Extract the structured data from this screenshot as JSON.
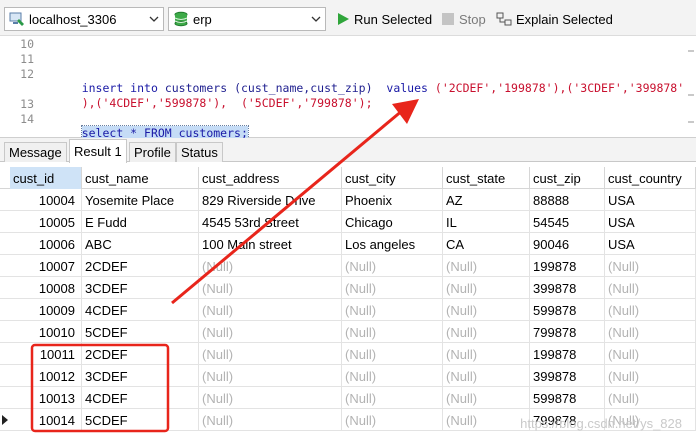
{
  "toolbar": {
    "connection": "localhost_3306",
    "database": "erp",
    "run_selected": "Run Selected",
    "stop": "Stop",
    "explain_selected": "Explain Selected"
  },
  "editor": {
    "lines": [
      {
        "num": "10"
      },
      {
        "num": "11"
      },
      {
        "num": "12",
        "insert_kw": "insert into",
        "table": "customers",
        "cols": "(cust_name,cust_zip)",
        "values_kw": "values",
        "vals": "('2CDEF','199878'),('3CDEF','399878'"
      },
      {
        "num": "",
        "cont": "),('4CDEF','599878'),  ('5CDEF','799878');"
      },
      {
        "num": "13"
      },
      {
        "num": "14",
        "select_sql": "select * FROM customers;"
      }
    ]
  },
  "tabs": [
    "Message",
    "Result 1",
    "Profile",
    "Status"
  ],
  "active_tab": "Result 1",
  "grid": {
    "columns": [
      "cust_id",
      "cust_name",
      "cust_address",
      "cust_city",
      "cust_state",
      "cust_zip",
      "cust_country"
    ],
    "rows": [
      [
        "10004",
        "Yosemite Place",
        "829 Riverside Drive",
        "Phoenix",
        "AZ",
        "88888",
        "USA"
      ],
      [
        "10005",
        "E Fudd",
        "4545 53rd Street",
        "Chicago",
        "IL",
        "54545",
        "USA"
      ],
      [
        "10006",
        "ABC",
        "100 Main street",
        "Los angeles",
        "CA",
        "90046",
        "USA"
      ],
      [
        "10007",
        "2CDEF",
        "(Null)",
        "(Null)",
        "(Null)",
        "199878",
        "(Null)"
      ],
      [
        "10008",
        "3CDEF",
        "(Null)",
        "(Null)",
        "(Null)",
        "399878",
        "(Null)"
      ],
      [
        "10009",
        "4CDEF",
        "(Null)",
        "(Null)",
        "(Null)",
        "599878",
        "(Null)"
      ],
      [
        "10010",
        "5CDEF",
        "(Null)",
        "(Null)",
        "(Null)",
        "799878",
        "(Null)"
      ],
      [
        "10011",
        "2CDEF",
        "(Null)",
        "(Null)",
        "(Null)",
        "199878",
        "(Null)"
      ],
      [
        "10012",
        "3CDEF",
        "(Null)",
        "(Null)",
        "(Null)",
        "399878",
        "(Null)"
      ],
      [
        "10013",
        "4CDEF",
        "(Null)",
        "(Null)",
        "(Null)",
        "599878",
        "(Null)"
      ],
      [
        "10014",
        "5CDEF",
        "(Null)",
        "(Null)",
        "(Null)",
        "799878",
        "(Null)"
      ]
    ]
  },
  "watermark": "https://blog.csdn.net/ys_828",
  "colors": {
    "annotation": "#e8251b",
    "run_green": "#2fa53a",
    "keyword": "#1a1aa6",
    "string": "#c8102e"
  }
}
